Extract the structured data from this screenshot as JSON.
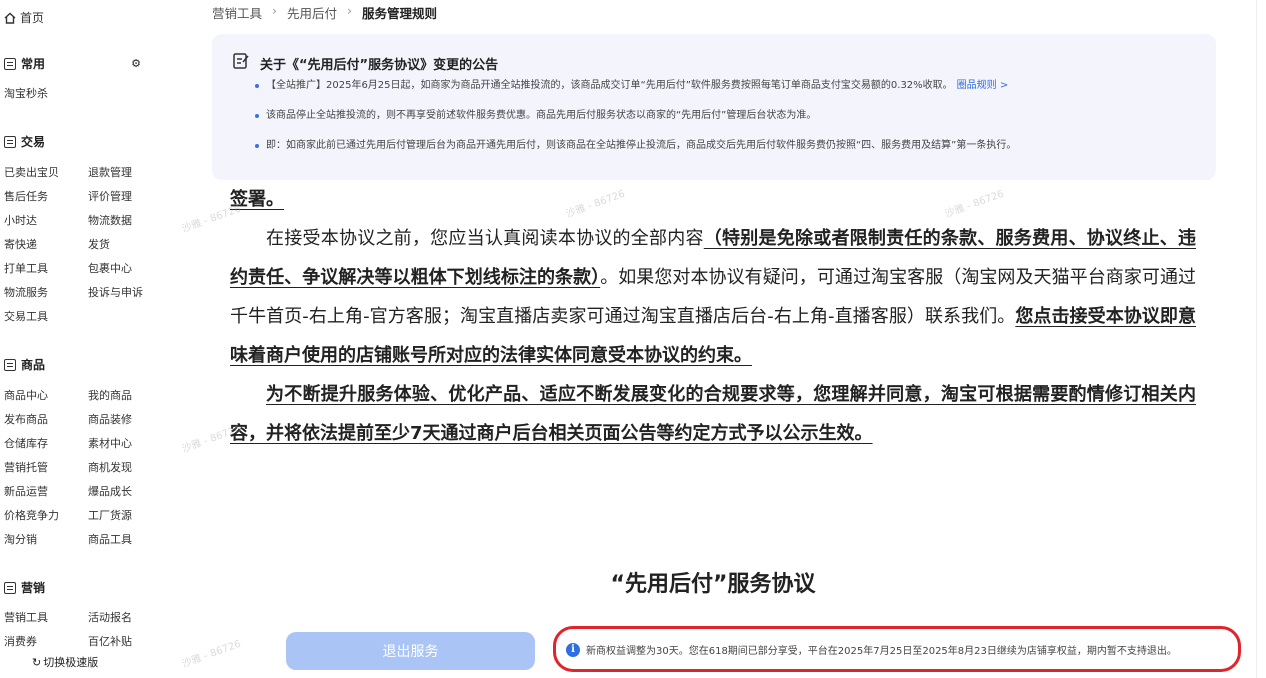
{
  "sidebar": {
    "home": "首页",
    "common": {
      "title": "常用",
      "items": [
        "淘宝秒杀"
      ]
    },
    "trade": {
      "title": "交易",
      "items": [
        "已卖出宝贝",
        "退款管理",
        "售后任务",
        "评价管理",
        "小时达",
        "物流数据",
        "寄快递",
        "发货",
        "打单工具",
        "包裹中心",
        "物流服务",
        "投诉与申诉",
        "交易工具"
      ]
    },
    "goods": {
      "title": "商品",
      "items": [
        "商品中心",
        "我的商品",
        "发布商品",
        "商品装修",
        "仓储库存",
        "素材中心",
        "营销托管",
        "商机发现",
        "新品运营",
        "爆品成长",
        "价格竞争力",
        "工厂货源",
        "淘分销",
        "商品工具"
      ]
    },
    "marketing": {
      "title": "营销",
      "items": [
        "营销工具",
        "活动报名",
        "消费券",
        "百亿补贴"
      ]
    },
    "switch_label": "切换极速版"
  },
  "breadcrumb": [
    "营销工具",
    "先用后付",
    "服务管理规则"
  ],
  "notice": {
    "title": "关于《“先用后付”服务协议》变更的公告",
    "items": [
      "【全站推广】2025年6月25日起，如商家为商品开通全站推投流的，该商品成交订单“先用后付”软件服务费按照每笔订单商品支付宝交易额的0.32%收取。",
      "该商品停止全站推投流的，则不再享受前述软件服务费优惠。商品先用后付服务状态以商家的“先用后付”管理后台状态为准。",
      "即：如商家此前已通过先用后付管理后台为商品开通先用后付，则该商品在全站推停止投流后，商品成交后先用后付软件服务费仍按照“四、服务费用及结算”第一条执行。"
    ],
    "link": "圈品规则 >"
  },
  "doc": {
    "line0": "签署。",
    "p1_a": "在接受本协议之前，您应当认真阅读本协议的全部内容",
    "p1_b": "（特别是免除或者限制责任的条款、服务费用、协议终止、违约责任、争议解决等以粗体下划线标注的条款）",
    "p1_c": "。如果您对本协议有疑问，可通过淘宝客服（淘宝网及天猫平台商家可通过千牛首页-右上角-官方客服；淘宝直播店卖家可通过淘宝直播店后台-右上角-直播客服）联系我们。",
    "p1_d": "您点击接受本协议即意味着商户使用的店铺账号所对应的法律实体同意受本协议的约束。",
    "p2": "为不断提升服务体验、优化产品、适应不断发展变化的合规要求等，您理解并同意，淘宝可根据需要酌情修订相关内容，并将依法提前至少7天通过商户后台相关页面公告等约定方式予以公示生效。",
    "title": "“先用后付”服务协议"
  },
  "watermark": "沙雅 - 86726",
  "exit_button": "退出服务",
  "bottom_note": "新商权益调整为30天。您在618期间已部分享受，平台在2025年7月25日至2025年8月23日继续为店铺享权益，期内暂不支持退出。",
  "colors": {
    "accent": "#2f6fe4",
    "exit_button": "#a9c4f5",
    "highlight_border": "#e0242a",
    "notice_bg": "#f4f5fc"
  }
}
